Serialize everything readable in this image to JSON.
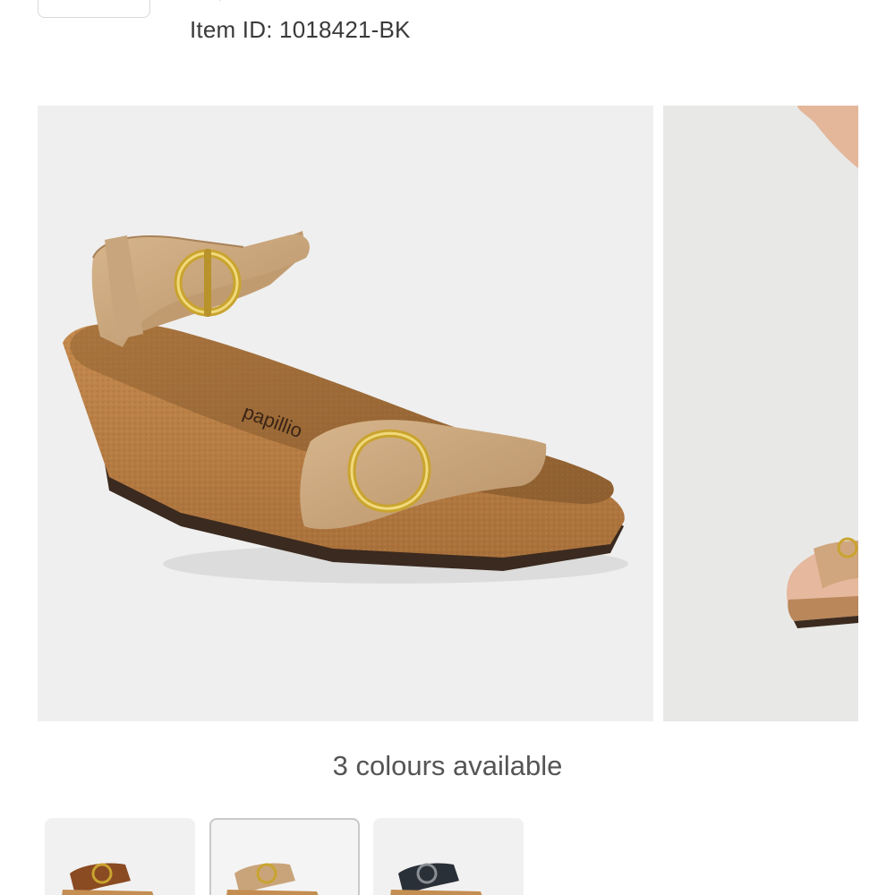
{
  "header": {
    "item_id_text": "Item ID: 1018421-BK"
  },
  "gallery": {
    "images": [
      {
        "icon": "sandal-product-image",
        "brand_mark": "papillio"
      },
      {
        "icon": "sandal-on-foot-image"
      }
    ]
  },
  "colours": {
    "count_text": "3 colours available",
    "swatches": [
      {
        "name": "cognac",
        "color": "#8a4a22",
        "selected": false
      },
      {
        "name": "sand",
        "color": "#c9a47a",
        "selected": true
      },
      {
        "name": "black",
        "color": "#2a3038",
        "selected": false
      }
    ]
  }
}
